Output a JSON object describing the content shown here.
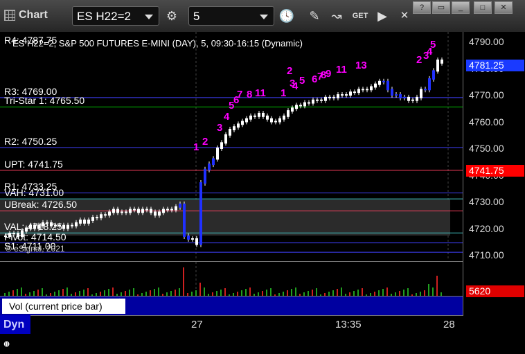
{
  "window": {
    "title": "Chart",
    "symbol": "ES H22=2",
    "interval": "5",
    "controls": [
      "minimize",
      "restore",
      "maximize",
      "close"
    ]
  },
  "chart": {
    "header": "ES H22=2, S&P 500 FUTURES E-MINI (DAY), 5, 09:30-16:15 (Dynamic)",
    "header_prefix": "R4: 4787.75",
    "watermark": "© eSignal, 2021",
    "watermark_ghost": "@ eSignal.com",
    "levels": [
      {
        "label": "R3: 4769.00",
        "color": "#4040ff",
        "price": 4769.0
      },
      {
        "label": "Tri-Star 1: 4765.50",
        "color": "#00c000",
        "price": 4765.5
      },
      {
        "label": "R2: 4750.25",
        "color": "#4040ff",
        "price": 4750.25
      },
      {
        "label": "UPT: 4741.75",
        "color": "#ff4060",
        "price": 4741.75
      },
      {
        "label": "R1: 4733.25",
        "color": "#4040ff",
        "price": 4733.25
      },
      {
        "label": "VAH: 4731.00",
        "color": "#40c0c0",
        "price": 4731.0
      },
      {
        "label": "UBreak: 4726.50",
        "color": "#ff4060",
        "price": 4726.5
      },
      {
        "label": "VAL: 4718.25",
        "color": "#40c0c0",
        "price": 4718.25
      },
      {
        "label": "Pivot: 4714.50",
        "color": "#4040ff",
        "price": 4714.5
      },
      {
        "label": "S1: 4711.00",
        "color": "#4040ff",
        "price": 4711.0
      }
    ],
    "seq_labels": [
      "1",
      "2",
      "3",
      "4",
      "5",
      "6",
      "7",
      "8",
      "11",
      "1",
      "2",
      "3",
      "4",
      "5",
      "6",
      "7",
      "8",
      "9",
      "11",
      "13",
      "2",
      "3",
      "4",
      "5"
    ],
    "td_labels": [
      "5",
      "6",
      "7",
      "8",
      "9"
    ]
  },
  "price_axis": {
    "ticks": [
      "4790.00",
      "4780.00",
      "4770.00",
      "4760.00",
      "4750.00",
      "4740.00",
      "4730.00",
      "4720.00",
      "4710.00"
    ],
    "last_price": "4781.25",
    "last_price_color": "#1a3aff",
    "upt_tag": "4741.75",
    "upt_tag_color": "#ff0000",
    "volume_tag": "5620",
    "volume_tag_color": "#e00000"
  },
  "volume_pane": {
    "legend": "Vol (current price bar)"
  },
  "time_axis": {
    "labels": [
      "27",
      "13:35",
      "28"
    ]
  },
  "status": {
    "mode": "Dyn"
  }
}
